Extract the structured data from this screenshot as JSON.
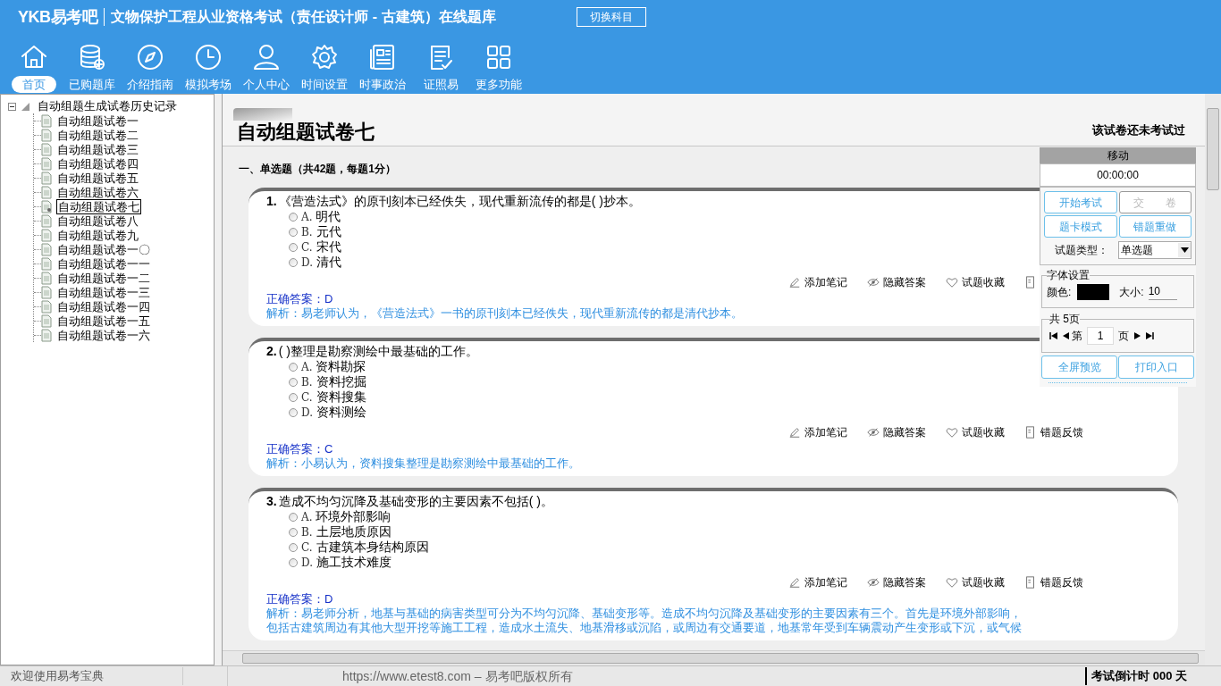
{
  "header": {
    "logo": "YKB易考吧",
    "title": "文物保护工程从业资格考试（责任设计师 - 古建筑）在线题库",
    "switch_button": "切换科目"
  },
  "toolbar": [
    {
      "label": "首页",
      "selected": true
    },
    {
      "label": "已购题库",
      "selected": false
    },
    {
      "label": "介绍指南",
      "selected": false
    },
    {
      "label": "模拟考场",
      "selected": false
    },
    {
      "label": "个人中心",
      "selected": false
    },
    {
      "label": "时间设置",
      "selected": false
    },
    {
      "label": "时事政治",
      "selected": false
    },
    {
      "label": "证照易",
      "selected": false
    },
    {
      "label": "更多功能",
      "selected": false
    }
  ],
  "tree": {
    "label": "自动组题生成试卷历史记录",
    "expanded": true,
    "children": [
      {
        "label": "自动组题试卷一",
        "selected": false
      },
      {
        "label": "自动组题试卷二",
        "selected": false
      },
      {
        "label": "自动组题试卷三",
        "selected": false
      },
      {
        "label": "自动组题试卷四",
        "selected": false
      },
      {
        "label": "自动组题试卷五",
        "selected": false
      },
      {
        "label": "自动组题试卷六",
        "selected": false
      },
      {
        "label": "自动组题试卷七",
        "selected": true
      },
      {
        "label": "自动组题试卷八",
        "selected": false
      },
      {
        "label": "自动组题试卷九",
        "selected": false
      },
      {
        "label": "自动组题试卷一〇",
        "selected": false
      },
      {
        "label": "自动组题试卷一一",
        "selected": false
      },
      {
        "label": "自动组题试卷一二",
        "selected": false
      },
      {
        "label": "自动组题试卷一三",
        "selected": false
      },
      {
        "label": "自动组题试卷一四",
        "selected": false
      },
      {
        "label": "自动组题试卷一五",
        "selected": false
      },
      {
        "label": "自动组题试卷一六",
        "selected": false
      }
    ]
  },
  "exam": {
    "title": "自动组题试卷七",
    "status": "该试卷还未考试过",
    "section": "一、单选题（共42题，每题1分）",
    "questions": [
      {
        "number": "1.",
        "stem": "《营造法式》的原刊刻本已经佚失，现代重新流传的都是(  )抄本。",
        "options": [
          {
            "letter": "A.",
            "text": "明代",
            "selected": false
          },
          {
            "letter": "B.",
            "text": "元代",
            "selected": false
          },
          {
            "letter": "C.",
            "text": "宋代",
            "selected": false
          },
          {
            "letter": "D.",
            "text": "清代",
            "selected": false
          }
        ],
        "actions": [
          "添加笔记",
          "隐藏答案",
          "试题收藏"
        ],
        "answer": "正确答案：D",
        "analysis": [
          "解析：易老师认为，《营造法式》一书的原刊刻本已经佚失，现代重新流传的都是清代抄本。"
        ]
      },
      {
        "number": "2.",
        "stem": "(  )整理是勘察测绘中最基础的工作。",
        "options": [
          {
            "letter": "A.",
            "text": "资料勘探",
            "selected": false
          },
          {
            "letter": "B.",
            "text": "资料挖掘",
            "selected": false
          },
          {
            "letter": "C.",
            "text": "资料搜集",
            "selected": false
          },
          {
            "letter": "D.",
            "text": "资料测绘",
            "selected": false
          }
        ],
        "actions": [
          "添加笔记",
          "隐藏答案",
          "试题收藏",
          "错题反馈"
        ],
        "answer": "正确答案：C",
        "analysis": [
          "解析：小易认为，资料搜集整理是勘察测绘中最基础的工作。"
        ]
      },
      {
        "number": "3.",
        "stem": "造成不均匀沉降及基础变形的主要因素不包括(  )。",
        "options": [
          {
            "letter": "A.",
            "text": "环境外部影响",
            "selected": false
          },
          {
            "letter": "B.",
            "text": "土层地质原因",
            "selected": false
          },
          {
            "letter": "C.",
            "text": "古建筑本身结构原因",
            "selected": false
          },
          {
            "letter": "D.",
            "text": "施工技术难度",
            "selected": false
          }
        ],
        "actions": [
          "添加笔记",
          "隐藏答案",
          "试题收藏",
          "错题反馈"
        ],
        "answer": "正确答案：D",
        "analysis": [
          "解析：易老师分析，地基与基础的病害类型可分为不均匀沉降、基础变形等。造成不均匀沉降及基础变形的主要因素有三个。首先是环境外部影响，",
          "包括古建筑周边有其他大型开挖等施工工程，造成水土流失、地基滑移或沉陷，或周边有交通要道，地基常年受到车辆震动产生变形或下沉，或气候"
        ]
      }
    ]
  },
  "panel": {
    "move": "移动",
    "timer": "00:00:00",
    "buttons": [
      {
        "label": "开始考试",
        "disabled": false
      },
      {
        "label": "交　　卷",
        "disabled": true
      },
      {
        "label": "题卡模式",
        "disabled": false
      },
      {
        "label": "错题重做",
        "disabled": false
      }
    ],
    "type_label": "试题类型：",
    "type_value": "单选题",
    "font_legend": "字体设置",
    "color_label": "颜色:",
    "color": "#000000",
    "size_label": "大小:",
    "size_value": "10",
    "pages_legend": "共 5页",
    "page_prefix": "第",
    "page_value": "1",
    "page_suffix": "页",
    "bottom_buttons": [
      "全屏预览",
      "打印入口"
    ]
  },
  "status_bar": {
    "left": "欢迎使用易考宝典",
    "center": "https://www.etest8.com – 易考吧版权所有",
    "right": "考试倒计时 000 天"
  }
}
